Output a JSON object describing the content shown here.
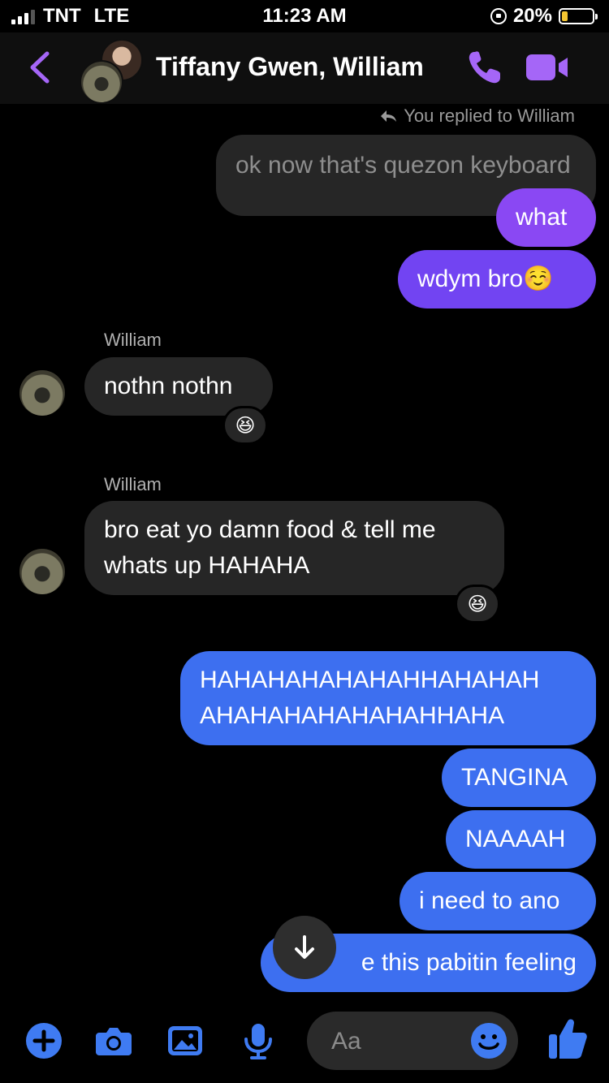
{
  "status_bar": {
    "carrier": "TNT",
    "network": "LTE",
    "time": "11:23 AM",
    "battery": "20%",
    "battery_level": 0.2,
    "signal_bars": 3
  },
  "header": {
    "title": "Tiffany Gwen, William",
    "accent_color": "#a566f7"
  },
  "conversation": {
    "replied_note": "You replied to William",
    "quoted_message": "ok now that's quezon keyboard",
    "messages_me_1": [
      "what",
      "wdym bro☺️"
    ],
    "group1": {
      "sender": "William",
      "text": "nothn nothn",
      "reaction": "😆"
    },
    "group2": {
      "sender": "William",
      "line1": "bro eat yo damn food & tell me",
      "line2": "whats up HAHAHA",
      "reaction": "😆"
    },
    "messages_me_2": {
      "laugh_line1": "HAHAHAHAHAHAHHAHAHAH",
      "laugh_line2": "AHAHAHAHAHAHAHHAHA",
      "m2": "TANGINA",
      "m3": "NAAAAH",
      "m4": "i need to ano",
      "m5_partial": "e this pabitin feeling"
    }
  },
  "composer": {
    "placeholder": "Aa"
  },
  "colors": {
    "bubble_purple": "#8a48f3",
    "bubble_violet": "#7244f2",
    "bubble_blue": "#3d6ff0",
    "bubble_incoming": "#262626",
    "composer_icon": "#3f7bf2"
  },
  "icons": [
    "back-chevron-icon",
    "phone-icon",
    "video-camera-icon",
    "reply-arrow-icon",
    "arrow-down-icon",
    "plus-icon",
    "camera-icon",
    "gallery-icon",
    "microphone-icon",
    "emoji-icon",
    "thumbs-up-icon"
  ]
}
